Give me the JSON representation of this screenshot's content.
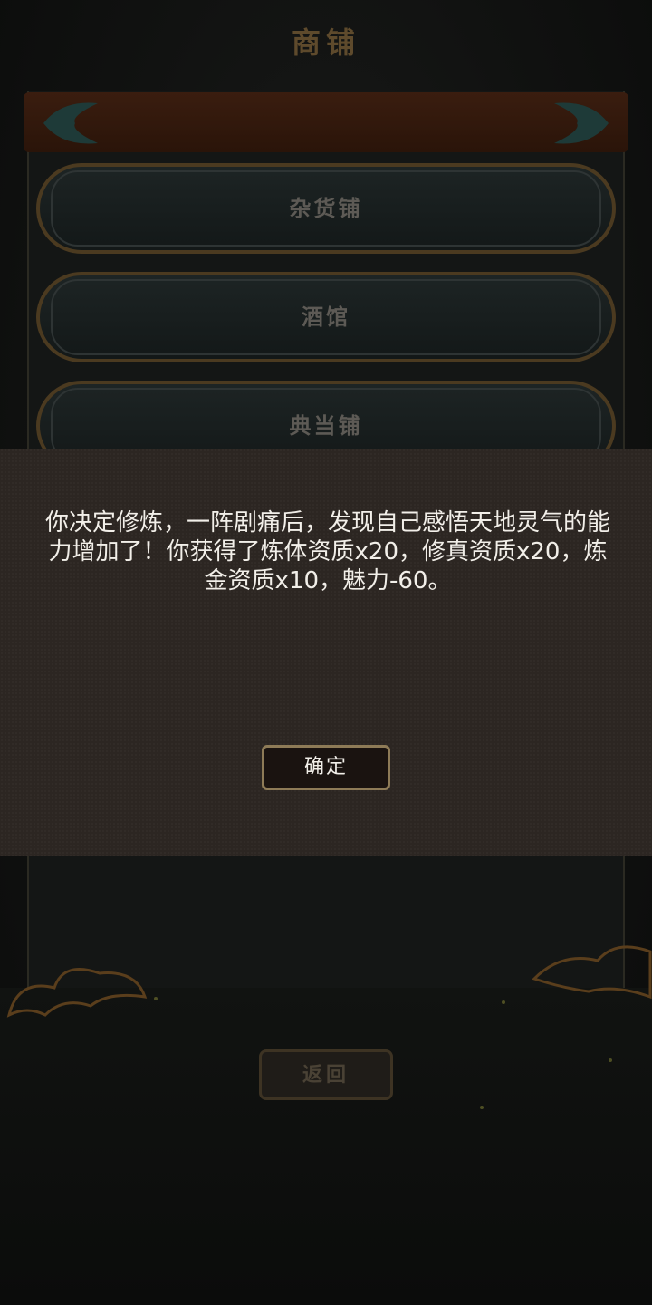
{
  "header": {
    "title": "商铺"
  },
  "shop_list": {
    "items": [
      {
        "label": "杂货铺"
      },
      {
        "label": "酒馆"
      },
      {
        "label": "典当铺"
      }
    ]
  },
  "dialog": {
    "message": "你决定修炼，一阵剧痛后，发现自己感悟天地灵气的能力增加了！你获得了炼体资质x20，修真资质x20，炼金资质x10，魅力-60。",
    "confirm_label": "确定"
  },
  "footer": {
    "back_label": "返回"
  },
  "colors": {
    "dialog_bg": "#2c2622",
    "button_border": "#8e7b57",
    "title_gold": "#5e4a2c"
  }
}
